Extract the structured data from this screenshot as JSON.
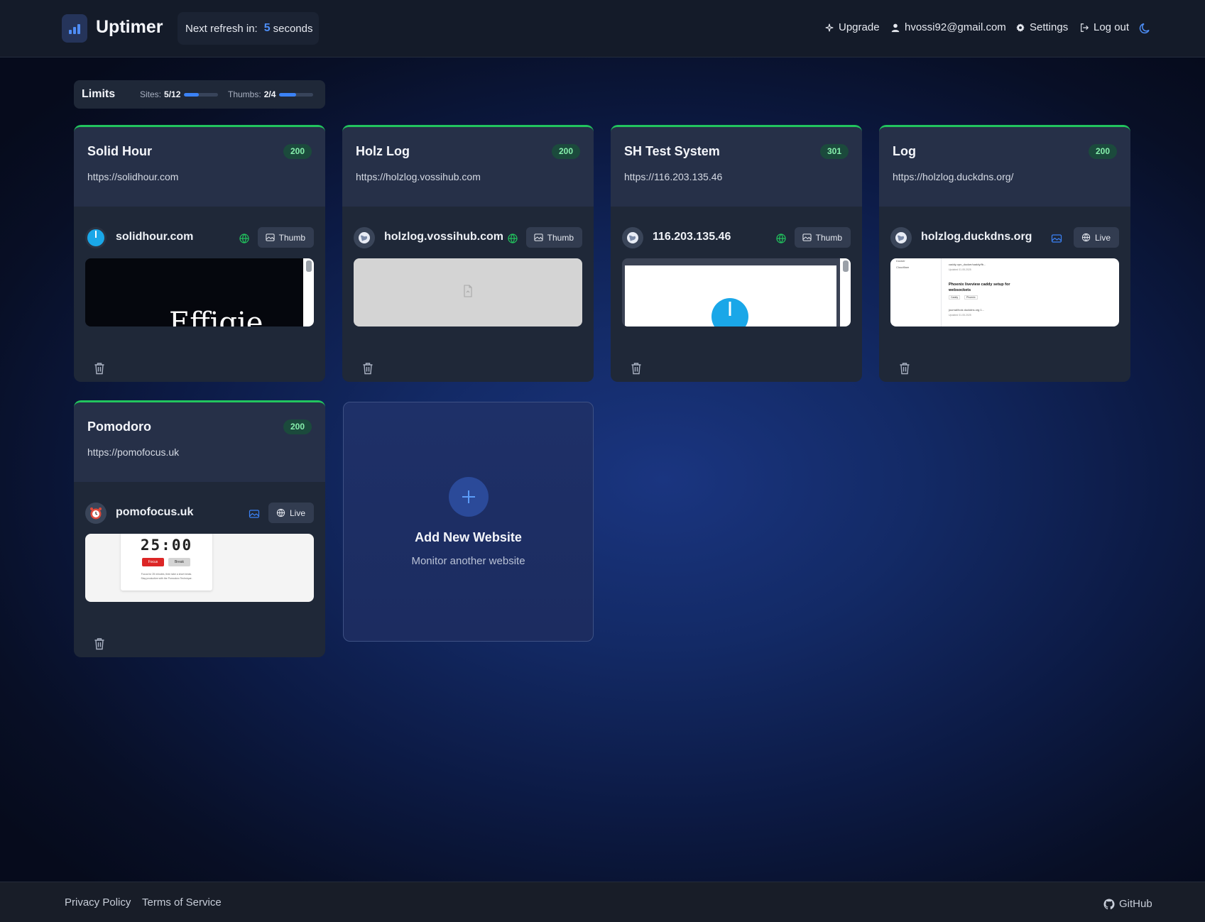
{
  "app": {
    "brand": "Uptimer",
    "refresh_label": "Next refresh in:",
    "refresh_value": "5",
    "refresh_unit": "seconds"
  },
  "nav": {
    "upgrade": "Upgrade",
    "email": "hvossi92@gmail.com",
    "settings": "Settings",
    "logout": "Log out"
  },
  "limits": {
    "title": "Limits",
    "sites_label": "Sites:",
    "sites_value": "5/12",
    "sites_fraction": 0.42,
    "thumbs_label": "Thumbs:",
    "thumbs_value": "2/4",
    "thumbs_fraction": 0.5
  },
  "colors": {
    "accent": "#3b82f6",
    "status_ok": "#22c55e",
    "badge_text": "#86efac"
  },
  "cards": [
    {
      "title": "Solid Hour",
      "status": "200",
      "url": "https://solidhour.com",
      "site": "solidhour.com",
      "mode": "Thumb",
      "mode_icon": "globe-icon",
      "preview": "dark-effigie",
      "preview_text": "Effigie"
    },
    {
      "title": "Holz Log",
      "status": "200",
      "url": "https://holzlog.vossihub.com",
      "site": "holzlog.vossihub.com",
      "mode": "Thumb",
      "mode_icon": "globe-icon",
      "preview": "blank"
    },
    {
      "title": "SH Test System",
      "status": "301",
      "url": "https://116.203.135.46",
      "site": "116.203.135.46",
      "mode": "Thumb",
      "mode_icon": "globe-icon",
      "preview": "white-circle"
    },
    {
      "title": "Log",
      "status": "200",
      "url": "https://holzlog.duckdns.org/",
      "site": "holzlog.duckdns.org",
      "mode": "Live",
      "mode_icon": "image-icon",
      "preview": "blog",
      "preview_lines": [
        "Docker",
        "Cloudflare",
        "caddy-vpn_docker/caddy/fb...",
        "Updated 01.05.2025",
        "Phoenix liveview caddy setup for websockets",
        "Caddy",
        "Phoenix",
        "journal/holz.duckdns.org 1...",
        "Updated 01.05.2025"
      ]
    },
    {
      "title": "Pomodoro",
      "status": "200",
      "url": "https://pomofocus.uk",
      "site": "pomofocus.uk",
      "mode": "Live",
      "mode_icon": "image-icon",
      "preview": "pomodoro",
      "timer": "25:00",
      "focus": "Focus",
      "break": "Break",
      "desc1": "Focus for 25 minutes, then take a short break.",
      "desc2": "Stay productive with the Pomodoro Technique."
    }
  ],
  "add_new": {
    "title": "Add New Website",
    "subtitle": "Monitor another website"
  },
  "footer": {
    "privacy": "Privacy Policy",
    "terms": "Terms of Service",
    "github": "GitHub"
  }
}
